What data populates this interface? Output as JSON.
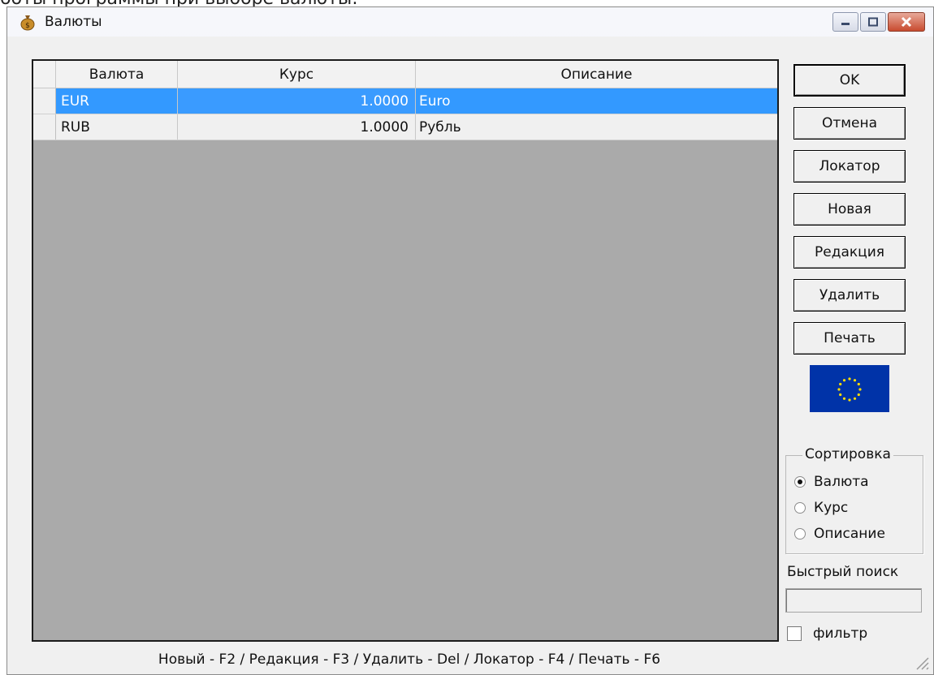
{
  "caption": "боты программы при выборе валюты:",
  "window": {
    "title": "Валюты",
    "title_icon": "money-bag-icon",
    "controls": [
      "minimize-icon",
      "maximize-icon",
      "close-icon"
    ]
  },
  "grid": {
    "columns": [
      "Валюта",
      "Курс",
      "Описание"
    ],
    "rows": [
      {
        "currency": "EUR",
        "rate": "1.0000",
        "description": "Euro",
        "selected": true
      },
      {
        "currency": "RUB",
        "rate": "1.0000",
        "description": "Рубль",
        "selected": false
      }
    ]
  },
  "buttons": {
    "ok": "OK",
    "cancel": "Отмена",
    "locator": "Локатор",
    "new": "Новая",
    "edit": "Редакция",
    "delete": "Удалить",
    "print": "Печать"
  },
  "flag_icon": "eu-flag-icon",
  "sort": {
    "legend": "Сортировка",
    "options": [
      "Валюта",
      "Курс",
      "Описание"
    ],
    "selected": "Валюта"
  },
  "quick_search": {
    "label": "Быстрый поиск",
    "value": ""
  },
  "filter": {
    "label": "фильтр",
    "checked": false
  },
  "status_hint": "Новый - F2 / Редакция - F3 / Удалить - Del / Локатор - F4 / Печать - F6",
  "colors": {
    "selection": "#3399ff",
    "grid_background": "#aaaaaa",
    "flag_blue": "#0033a8",
    "flag_stars": "#ffdd00"
  }
}
